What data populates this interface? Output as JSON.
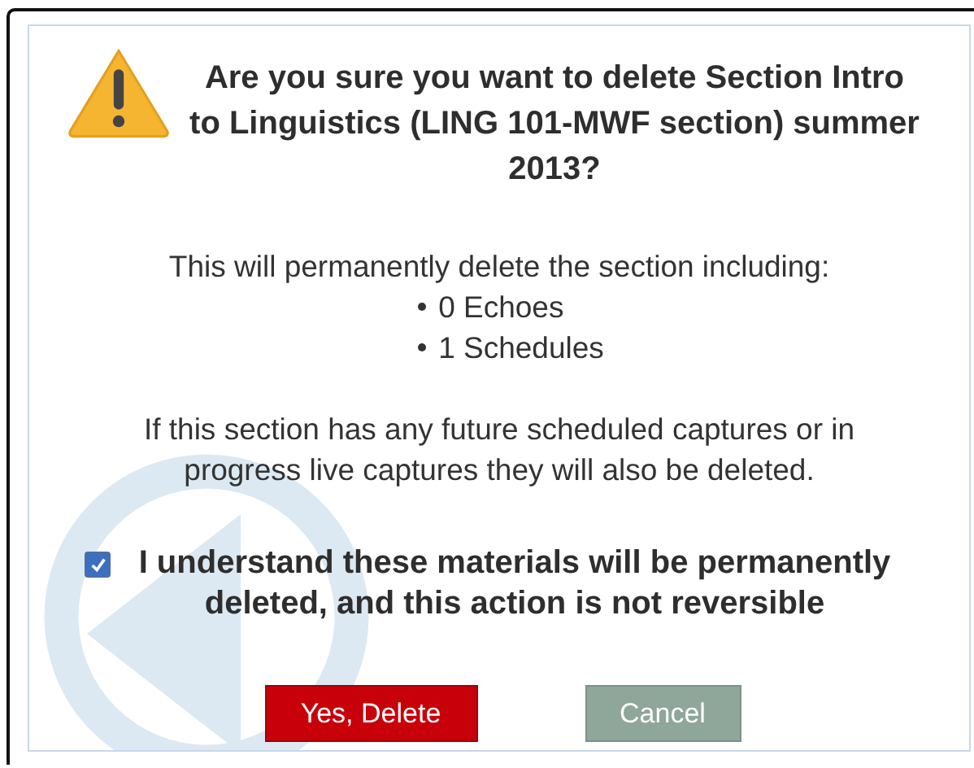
{
  "dialog": {
    "title": "Are you sure you want to delete Section Intro to Linguistics (LING 101-MWF section) summer 2013?",
    "intro": "This will permanently delete the section including:",
    "items": [
      "0 Echoes",
      "1 Schedules"
    ],
    "warning": "If this section has any future scheduled captures or in progress live captures they will also be deleted.",
    "confirm": {
      "label": "I understand these materials will be permanently deleted, and this action is not reversible",
      "checked": true
    },
    "buttons": [
      {
        "label": "Yes, Delete",
        "kind": "danger"
      },
      {
        "label": "Cancel",
        "kind": "secondary"
      }
    ]
  }
}
